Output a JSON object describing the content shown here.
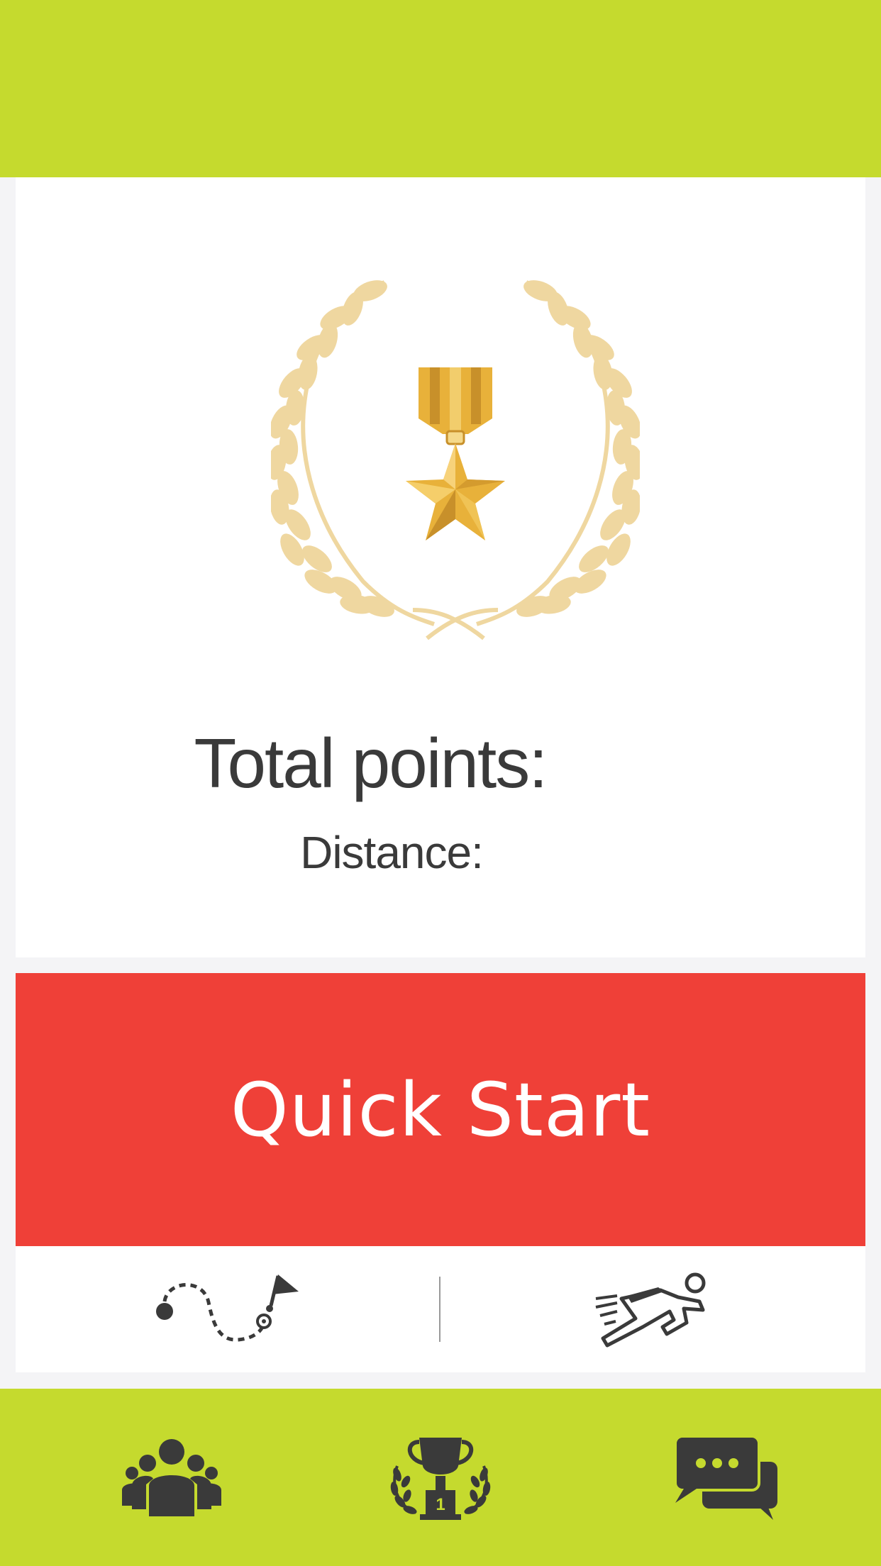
{
  "screen": {
    "total_points_label": "Total points:",
    "distance_label": "Distance:",
    "quick_start_label": "Quick Start"
  },
  "icons": {
    "award": "medal-laurel-icon",
    "route": "route-flag-icon",
    "sprint": "sprinter-icon",
    "community": "group-icon",
    "leaderboard": "trophy-icon",
    "chat": "chat-bubbles-icon"
  },
  "colors": {
    "header": "#c5da2e",
    "quick_start": "#ef4038",
    "text": "#3a3a3a",
    "gold": "#e8b13a",
    "laurel": "#efd7a0"
  }
}
